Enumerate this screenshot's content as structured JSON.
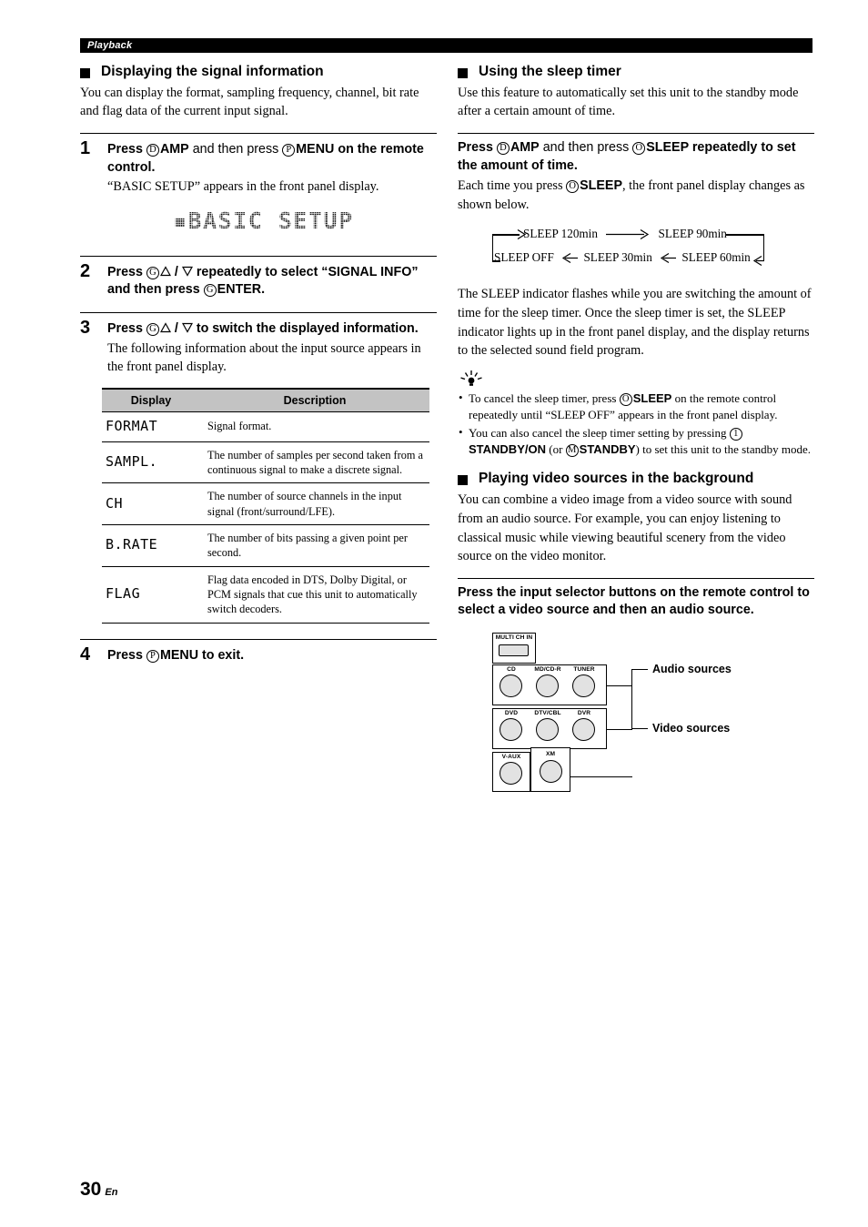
{
  "header": {
    "section_label": "Playback"
  },
  "footer": {
    "page_number": "30",
    "language_code": "En"
  },
  "left": {
    "heading": "Displaying the signal information",
    "intro": "You can display the format, sampling frequency, channel, bit rate and flag data of the current input signal.",
    "step1": {
      "num": "1",
      "title_a": "Press ",
      "badge_d": "D",
      "title_b": "AMP",
      "title_c": " and then press ",
      "badge_p": "P",
      "title_d": "MENU",
      "title_e": " on the remote control.",
      "desc": "“BASIC SETUP” appears in the front panel display.",
      "lcd_text": "BASIC SETUP"
    },
    "step2": {
      "num": "2",
      "title_a": "Press ",
      "badge_g": "G",
      "title_b": " / ",
      "title_c": " repeatedly to select “SIGNAL INFO” and then press ",
      "badge_g2": "G",
      "title_d": "ENTER."
    },
    "step3": {
      "num": "3",
      "title_a": "Press ",
      "badge_g": "G",
      "title_b": " / ",
      "title_c": " to switch the displayed information.",
      "desc": "The following information about the input source appears in the front panel display."
    },
    "table": {
      "columns": [
        "Display",
        "Description"
      ],
      "rows": [
        {
          "display": "FORMAT",
          "description": "Signal format."
        },
        {
          "display": "SAMPL.",
          "description": "The number of samples per second taken from a continuous signal to make a discrete signal."
        },
        {
          "display": "CH",
          "description": "The number of source channels in the input signal (front/surround/LFE)."
        },
        {
          "display": "B.RATE",
          "description": "The number of bits passing a given point per second."
        },
        {
          "display": "FLAG",
          "description": "Flag data encoded in DTS, Dolby Digital, or PCM signals that cue this unit to automatically switch decoders."
        }
      ]
    },
    "step4": {
      "num": "4",
      "title_a": "Press ",
      "badge_p": "P",
      "title_b": "MENU",
      "title_c": " to exit."
    }
  },
  "right": {
    "sleep": {
      "heading": "Using the sleep timer",
      "intro": "Use this feature to automatically set this unit to the standby mode after a certain amount of time.",
      "instruction_a": "Press ",
      "badge_d": "D",
      "instruction_b": "AMP",
      "instruction_c": " and then press ",
      "badge_o": "O",
      "instruction_d": "SLEEP",
      "instruction_e": " repeatedly to set the amount of time.",
      "sub_a": "Each time you press ",
      "badge_o2": "O",
      "sub_b": "SLEEP",
      "sub_c": ", the front panel display changes as shown below.",
      "cycle": {
        "top": [
          "SLEEP  120min",
          "SLEEP  90min"
        ],
        "bottom": [
          "SLEEP  OFF",
          "SLEEP  30min",
          "SLEEP  60min"
        ]
      },
      "body": "The SLEEP indicator flashes while you are switching the amount of time for the sleep timer. Once the sleep timer is set, the SLEEP indicator lights up in the front panel display, and the display returns to the selected sound field program.",
      "tips": [
        {
          "a": "To cancel the sleep timer, press ",
          "badge": "O",
          "b": "SLEEP",
          "c": " on the remote control repeatedly until “SLEEP OFF” appears in the front panel display."
        },
        {
          "a": "You can also cancel the sleep timer setting by pressing ",
          "badge": "1",
          "b": "STANDBY/ON",
          "mid": " (or ",
          "badge2": "M",
          "b2": "STANDBY",
          "c": ") to set this unit to the standby mode."
        }
      ]
    },
    "background": {
      "heading": "Playing video sources in the background",
      "intro": "You can combine a video image from a video source with sound from an audio source. For example, you can enjoy listening to classical music while viewing beautiful scenery from the video source on the video monitor.",
      "instruction": "Press the input selector buttons on the remote control to select a video source and then an audio source.",
      "remote": {
        "multi_label": "MULTI CH IN",
        "audio_buttons": [
          "CD",
          "MD/CD-R",
          "TUNER"
        ],
        "video_buttons": [
          "DVD",
          "DTV/CBL",
          "DVR"
        ],
        "extra_buttons": [
          "V-AUX",
          "XM"
        ],
        "callout_audio": "Audio sources",
        "callout_video": "Video sources"
      }
    }
  }
}
